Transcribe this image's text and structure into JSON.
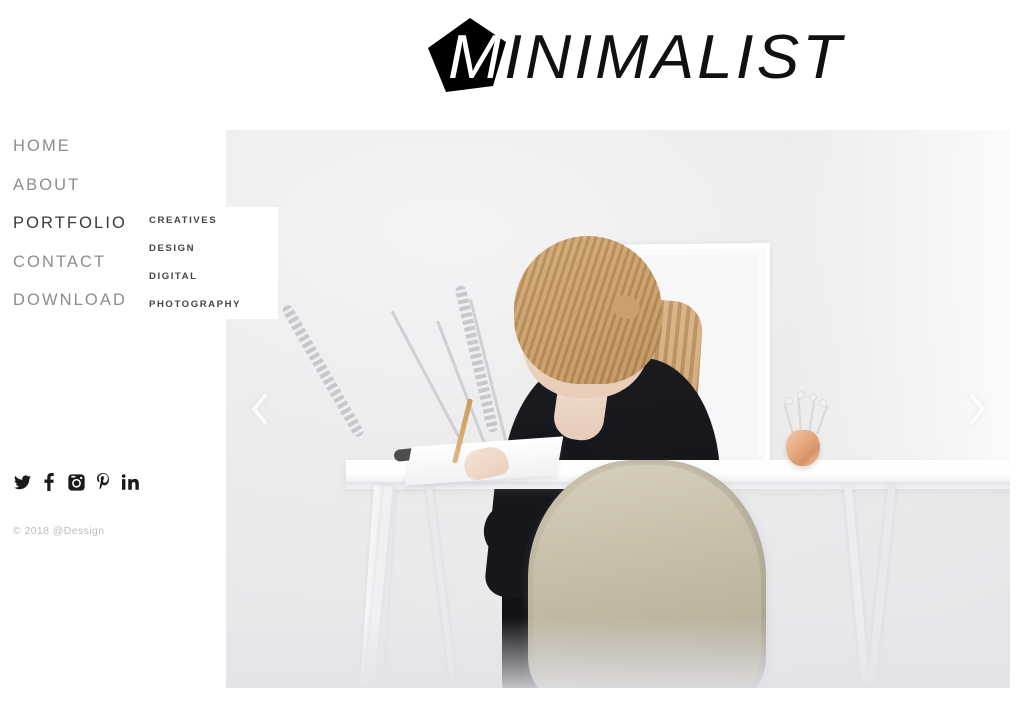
{
  "site": {
    "title": "MINIMALIST",
    "logo_first_letter": "M",
    "logo_rest": "INIMALIST",
    "logo_mark_icon": "pentagon-logo-icon"
  },
  "nav": {
    "items": [
      {
        "label": "HOME",
        "name": "home",
        "active": false
      },
      {
        "label": "ABOUT",
        "name": "about",
        "active": false
      },
      {
        "label": "PORTFOLIO",
        "name": "portfolio",
        "active": true
      },
      {
        "label": "CONTACT",
        "name": "contact",
        "active": false
      },
      {
        "label": "DOWNLOAD",
        "name": "download",
        "active": false
      }
    ]
  },
  "submenu": {
    "parent": "PORTFOLIO",
    "items": [
      {
        "label": "CREATIVES",
        "name": "creatives"
      },
      {
        "label": "DESIGN",
        "name": "design"
      },
      {
        "label": "DIGITAL",
        "name": "digital"
      },
      {
        "label": "PHOTOGRAPHY",
        "name": "photography"
      }
    ]
  },
  "social": {
    "items": [
      {
        "label": "Twitter",
        "icon": "twitter-icon"
      },
      {
        "label": "Facebook",
        "icon": "facebook-icon"
      },
      {
        "label": "Instagram",
        "icon": "instagram-icon"
      },
      {
        "label": "Pinterest",
        "icon": "pinterest-icon"
      },
      {
        "label": "LinkedIn",
        "icon": "linkedin-icon"
      }
    ]
  },
  "footer": {
    "copyright": "© 2018 @Dessign"
  },
  "slider": {
    "prev_label": "Previous slide",
    "next_label": "Next slide",
    "prev_icon": "chevron-left-icon",
    "next_icon": "chevron-right-icon",
    "slide_alt": "Woman with long blonde ponytail in a black top writing in a notebook at a white minimalist desk, with dried grass stems, a framed print and a copper vase"
  },
  "colors": {
    "page_background": "#ffffff",
    "nav_text": "#8d8d8d",
    "nav_text_active": "#3a3a3a",
    "submenu_text": "#444444",
    "submenu_panel": "#ffffff",
    "copyright_text": "#bcbcbc",
    "logo_text": "#111111",
    "logo_mark": "#000000",
    "photo_background": "#e9e9ed",
    "chair": "#bdb59f",
    "vase_copper": "#e8ab82",
    "hair": "#cda26c",
    "top_black": "#16171b"
  }
}
